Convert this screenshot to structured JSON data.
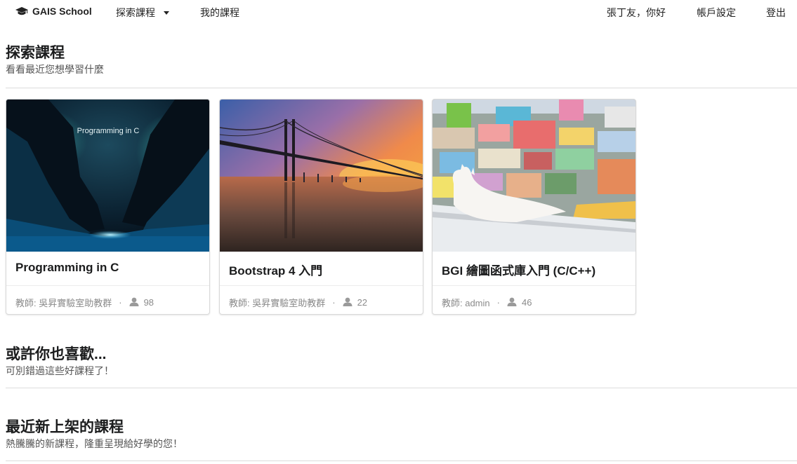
{
  "nav": {
    "brand": "GAIS School",
    "explore": "探索課程",
    "my_courses": "我的課程",
    "greeting": "張丁友，你好",
    "settings": "帳戶設定",
    "logout": "登出"
  },
  "sections": {
    "explore": {
      "title": "探索課程",
      "subtitle": "看看最近您想學習什麼"
    },
    "recommend": {
      "title": "或許你也喜歡...",
      "subtitle": "可別錯過這些好課程了！"
    },
    "newest": {
      "title": "最近新上架的課程",
      "subtitle": "熱騰騰的新課程，隆重呈現給好學的您！"
    }
  },
  "courses": [
    {
      "title": "Programming in C",
      "image_text": "Programming in C",
      "teacher": "教師: 吳昇實驗室助教群",
      "students": "98"
    },
    {
      "title": "Bootstrap 4 入門",
      "teacher": "教師: 吳昇實驗室助教群",
      "students": "22"
    },
    {
      "title": "BGI 繪圖函式庫入門 (C/C++)",
      "teacher": "教師: admin",
      "students": "46"
    }
  ],
  "icons": {
    "brand": "graduation-cap-icon",
    "dropdown": "caret-down-icon",
    "students": "user-icon"
  },
  "colors": {
    "text": "#1b1c1d",
    "muted": "#8a8a8a",
    "divider": "#dcdcdc"
  }
}
